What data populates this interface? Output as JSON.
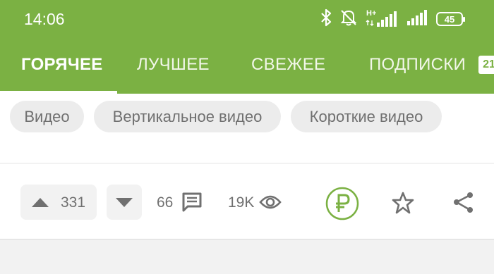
{
  "status_bar": {
    "time": "14:06",
    "network_label": "H+",
    "battery_level": "45",
    "icons": [
      "bluetooth-icon",
      "bell-off-icon",
      "signal-icon",
      "signal-icon",
      "battery-icon"
    ]
  },
  "tabs": [
    {
      "label": "ГОРЯЧЕЕ",
      "active": true
    },
    {
      "label": "ЛУЧШЕЕ",
      "active": false
    },
    {
      "label": "СВЕЖЕЕ",
      "active": false
    },
    {
      "label": "ПОДПИСКИ",
      "active": false
    }
  ],
  "tab_badge": "21",
  "tags": [
    "Видео",
    "Вертикальное видео",
    "Короткие видео"
  ],
  "post_actions": {
    "rating": "331",
    "comments": "66",
    "views": "19K",
    "donate_icon": "ruble-icon",
    "save_icon": "star-icon",
    "share_icon": "share-icon"
  },
  "colors": {
    "brand_green": "#7bb143",
    "panel_background": "#ffffff",
    "page_background": "#f2f2f2",
    "text_gray": "#707070"
  }
}
